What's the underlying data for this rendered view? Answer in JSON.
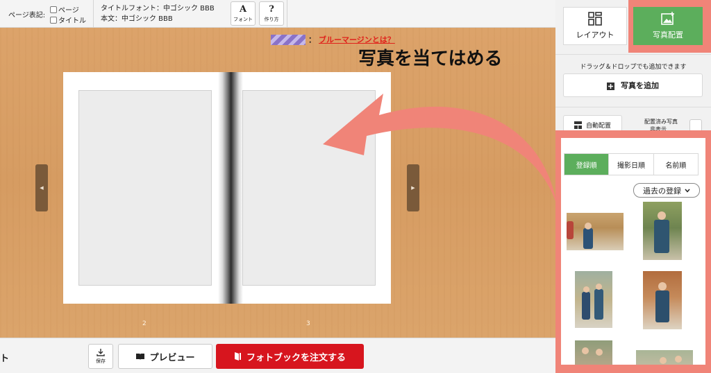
{
  "toolbar": {
    "page_notation_label": "ページ表記:",
    "check_page_label": "ページ",
    "check_title_label": "タイトル",
    "title_font_text": "タイトルフォント：中ゴシック BBB",
    "body_font_text": "本文：中ゴシック BBB",
    "font_button_glyph": "A",
    "font_button_label": "フォント",
    "howto_button_glyph": "?",
    "howto_button_label": "作り方"
  },
  "canvas": {
    "blue_margin_colon": "：",
    "blue_margin_link": "ブルーマージンとは？",
    "page_numbers": [
      "2",
      "3"
    ],
    "annotation": "写真を当てはめる",
    "prev_arrow": "◀",
    "next_arrow": "▶"
  },
  "bottombar": {
    "left_text": "ト",
    "save_label": "保存",
    "preview_label": "プレビュー",
    "order_label": "フォトブックを注文する"
  },
  "panel": {
    "tab_layout_label": "レイアウト",
    "tab_photo_label": "写真配置",
    "dnd_note": "ドラッグ＆ドロップでも追加できます",
    "add_photo_label": "写真を追加",
    "auto_place_label": "自動配置",
    "placed_photos_label": "配置済み写真",
    "placed_photos_sub": "非表示",
    "sort_tabs": [
      "登録順",
      "撮影日順",
      "名前順"
    ],
    "period_select": "過去の登録"
  },
  "colors": {
    "accent_green": "#5cae5c",
    "highlight_salmon": "#f08478",
    "order_red": "#d7151e",
    "link_red": "#e0211b",
    "wood": "#d69c62"
  }
}
